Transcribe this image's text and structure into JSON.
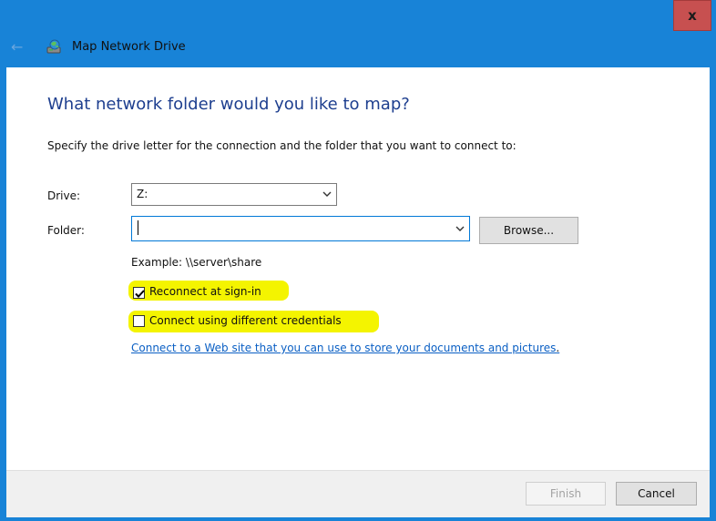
{
  "window": {
    "title": "Map Network Drive",
    "close_glyph": "x",
    "back_glyph": "←",
    "app_icon": "network-drive-icon",
    "accent_color": "#1883d7",
    "close_color": "#c75050"
  },
  "main": {
    "heading": "What network folder would you like to map?",
    "instruction": "Specify the drive letter for the connection and the folder that you want to connect to:",
    "drive_label": "Drive:",
    "drive_value": "Z:",
    "folder_label": "Folder:",
    "folder_value": "",
    "browse_label": "Browse...",
    "example": "Example: \\\\server\\share",
    "reconnect": {
      "label": "Reconnect at sign-in",
      "checked": true
    },
    "different_credentials": {
      "label": "Connect using different credentials",
      "checked": false
    },
    "website_link": "Connect to a Web site that you can use to store your documents and pictures",
    "website_link_suffix": ".",
    "highlight_color": "#f4f400"
  },
  "footer": {
    "finish_label": "Finish",
    "finish_enabled": false,
    "cancel_label": "Cancel"
  }
}
